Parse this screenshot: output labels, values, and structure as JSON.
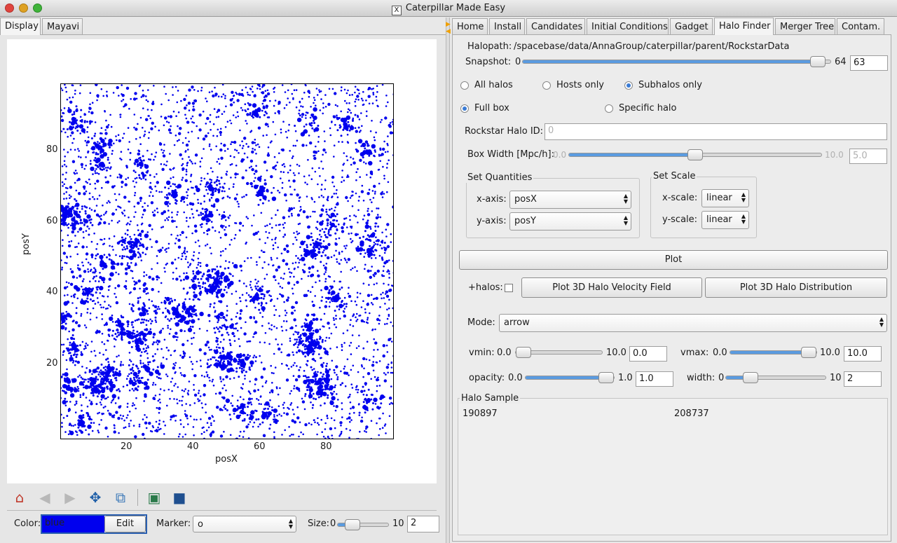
{
  "window": {
    "title": "Caterpillar Made Easy",
    "x_icon": "X"
  },
  "left_tabs": [
    "Display",
    "Mayavi"
  ],
  "right_tabs": [
    "Home",
    "Install",
    "Candidates",
    "Initial Conditions",
    "Gadget",
    "Halo Finder",
    "Merger Tree",
    "Contam."
  ],
  "active_right_tab": "Halo Finder",
  "plot": {
    "xlabel": "posX",
    "ylabel": "posY",
    "xticks": [
      "20",
      "40",
      "60",
      "80"
    ],
    "yticks": [
      "80",
      "60",
      "40",
      "20"
    ],
    "marker_color": "#0000ee"
  },
  "bottom": {
    "color_label": "Color:",
    "color_value": "blue",
    "edit_label": "Edit",
    "marker_label": "Marker:",
    "marker_value": "o",
    "size_label": "Size:",
    "size_min": "0",
    "size_max": "10",
    "size_value": "2",
    "size_level": 0.2
  },
  "halo": {
    "halopath_label": "Halopath:",
    "halopath_value": "/spacebase/data/AnnaGroup/caterpillar/parent/RockstarData",
    "snapshot_label": "Snapshot:",
    "snapshot_min": "0",
    "snapshot_max": "64",
    "snapshot_value": "63",
    "snapshot_level": 0.984,
    "radio_all": "All halos",
    "radio_hosts": "Hosts only",
    "radio_subhalos": "Subhalos only",
    "radio_fullbox": "Full box",
    "radio_specific": "Specific halo",
    "rockstar_label": "Rockstar Halo ID:",
    "rockstar_placeholder": "0",
    "boxwidth_label": "Box Width [Mpc/h]:",
    "boxwidth_min": "0.0",
    "boxwidth_max": "10.0",
    "boxwidth_value": "5.0",
    "boxwidth_level": 0.5
  },
  "quantities": {
    "title": "Set Quantities",
    "xaxis_label": "x-axis:",
    "xaxis_value": "posX",
    "yaxis_label": "y-axis:",
    "yaxis_value": "posY"
  },
  "scale": {
    "title": "Set Scale",
    "xscale_label": "x-scale:",
    "xscale_value": "linear",
    "yscale_label": "y-scale:",
    "yscale_value": "linear"
  },
  "actions": {
    "plot_label": "Plot",
    "halos_label": "+halos:",
    "velocity_label": "Plot 3D Halo Velocity Field",
    "distribution_label": "Plot 3D Halo Distribution"
  },
  "mayavi": {
    "mode_label": "Mode:",
    "mode_value": "arrow",
    "vmin_label": "vmin:",
    "vmin_min": "0.0",
    "vmin_max": "10.0",
    "vmin_value": "0.0",
    "vmin_level": 0.0,
    "vmax_label": "vmax:",
    "vmax_min": "0.0",
    "vmax_max": "10.0",
    "vmax_value": "10.0",
    "vmax_level": 1.0,
    "opacity_label": "opacity:",
    "opacity_min": "0.0",
    "opacity_max": "1.0",
    "opacity_value": "1.0",
    "opacity_level": 1.0,
    "width_label": "width:",
    "width_min": "0",
    "width_max": "10",
    "width_value": "2",
    "width_level": 0.2
  },
  "sample": {
    "title": "Halo Sample",
    "ids": [
      "190897",
      "208737"
    ]
  }
}
